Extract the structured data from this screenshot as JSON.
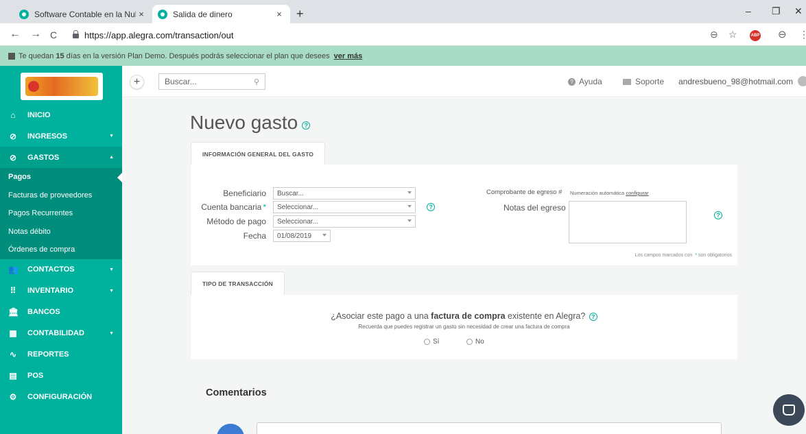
{
  "browser": {
    "tabs": [
      {
        "label": "Software Contable en la Nube pa",
        "close": "×"
      },
      {
        "label": "Salida de dinero",
        "close": "×"
      }
    ],
    "new_tab": "+",
    "window_controls": {
      "minimize": "–",
      "maximize": "❐",
      "close": "✕"
    },
    "nav": {
      "back": "←",
      "forward": "→",
      "reload": "C"
    },
    "url": "https://app.alegra.com/transaction/out",
    "icons": {
      "zoom": "⊖",
      "star": "☆",
      "abp": "ABP",
      "profile": "⊖",
      "menu": "⋮"
    }
  },
  "banner": {
    "text_before": "Te quedan",
    "days": "15",
    "text_after": "días en la versión Plan Demo. Después podrás seleccionar el plan que desees",
    "link": "ver más"
  },
  "sidebar": {
    "items": [
      {
        "label": "INICIO",
        "icon": "⌂"
      },
      {
        "label": "INGRESOS",
        "icon": "⊘",
        "caret": "▼"
      },
      {
        "label": "GASTOS",
        "icon": "⊘",
        "caret": "▲"
      },
      {
        "label": "CONTACTOS",
        "icon": "👥",
        "caret": "▼"
      },
      {
        "label": "INVENTARIO",
        "icon": "⠿",
        "caret": "▼"
      },
      {
        "label": "BANCOS",
        "icon": "🏛",
        "caret": ""
      },
      {
        "label": "CONTABILIDAD",
        "icon": "▦",
        "caret": "▼"
      },
      {
        "label": "REPORTES",
        "icon": "∿",
        "caret": ""
      },
      {
        "label": "POS",
        "icon": "▤",
        "caret": ""
      },
      {
        "label": "CONFIGURACIÓN",
        "icon": "⚙",
        "caret": ""
      }
    ],
    "subitems": [
      "Pagos",
      "Facturas de proveedores",
      "Pagos Recurrentes",
      "Notas débito",
      "Órdenes de compra"
    ]
  },
  "appbar": {
    "plus": "+",
    "search_placeholder": "Buscar...",
    "help": "Ayuda",
    "support": "Soporte",
    "user": "andresbueno_98@hotmail.com"
  },
  "page": {
    "title": "Nuevo gasto",
    "help_glyph": "?",
    "section1_tab": "INFORMACIÓN GENERAL DEL GASTO",
    "section2_tab": "TIPO DE TRANSACCIÓN",
    "comments_title": "Comentarios"
  },
  "form": {
    "beneficiario_label": "Beneficiario",
    "beneficiario_value": "Buscar...",
    "cuenta_label": "Cuenta bancaria",
    "required_mark": "*",
    "cuenta_value": "Seleccionar...",
    "metodo_label": "Método de pago",
    "metodo_value": "Seleccionar...",
    "fecha_label": "Fecha",
    "fecha_value": "01/08/2019",
    "comprobante_label": "Comprobante de egreso #",
    "comprobante_value": "Numeración automática",
    "configurar_link": "configurar",
    "notas_label": "Notas del egreso",
    "required_note_before": "Los campos marcados con",
    "required_note_after": "son obligatorios"
  },
  "transaction": {
    "question_before": "¿Asociar este pago a una",
    "question_bold": "factura de compra",
    "question_after": "existente en Alegra?",
    "hint": "Recuerda que puedes registrar un gasto sin necesidad de crear una factura de compra",
    "option_yes": "Sí",
    "option_no": "No"
  },
  "colors": {
    "brand": "#00b19d",
    "banner": "#a9dcc6",
    "chat": "#3a4858"
  }
}
